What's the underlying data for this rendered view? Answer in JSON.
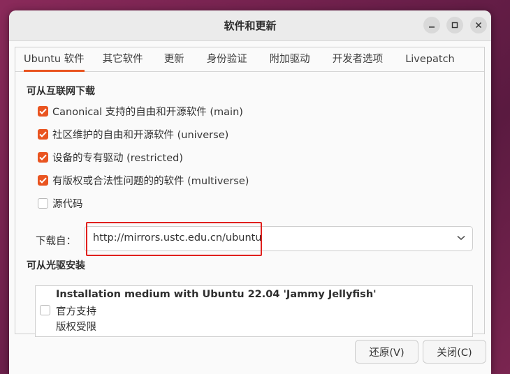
{
  "window": {
    "title": "软件和更新"
  },
  "tabs": [
    {
      "label": "Ubuntu 软件",
      "active": true
    },
    {
      "label": "其它软件",
      "active": false
    },
    {
      "label": "更新",
      "active": false
    },
    {
      "label": "身份验证",
      "active": false
    },
    {
      "label": "附加驱动",
      "active": false
    },
    {
      "label": "开发者选项",
      "active": false
    },
    {
      "label": "Livepatch",
      "active": false
    }
  ],
  "internet_section": {
    "title": "可从互联网下载",
    "options": [
      {
        "label": "Canonical 支持的自由和开源软件 (main)",
        "checked": true
      },
      {
        "label": "社区维护的自由和开源软件 (universe)",
        "checked": true
      },
      {
        "label": "设备的专有驱动 (restricted)",
        "checked": true
      },
      {
        "label": "有版权或合法性问题的的软件 (multiverse)",
        "checked": true
      },
      {
        "label": "源代码",
        "checked": false
      }
    ],
    "download_from_label": "下载自：",
    "download_from_value": "http://mirrors.ustc.edu.cn/ubuntu"
  },
  "cdrom_section": {
    "title": "可从光驱安装",
    "item": {
      "name": "Installation medium with Ubuntu 22.04 'Jammy Jellyfish'",
      "line2": "官方支持",
      "line3": "版权受限",
      "checked": false
    }
  },
  "buttons": {
    "revert": "还原(V)",
    "close": "关闭(C)"
  },
  "colors": {
    "accent": "#e95420",
    "highlight_box": "#e0201d"
  }
}
